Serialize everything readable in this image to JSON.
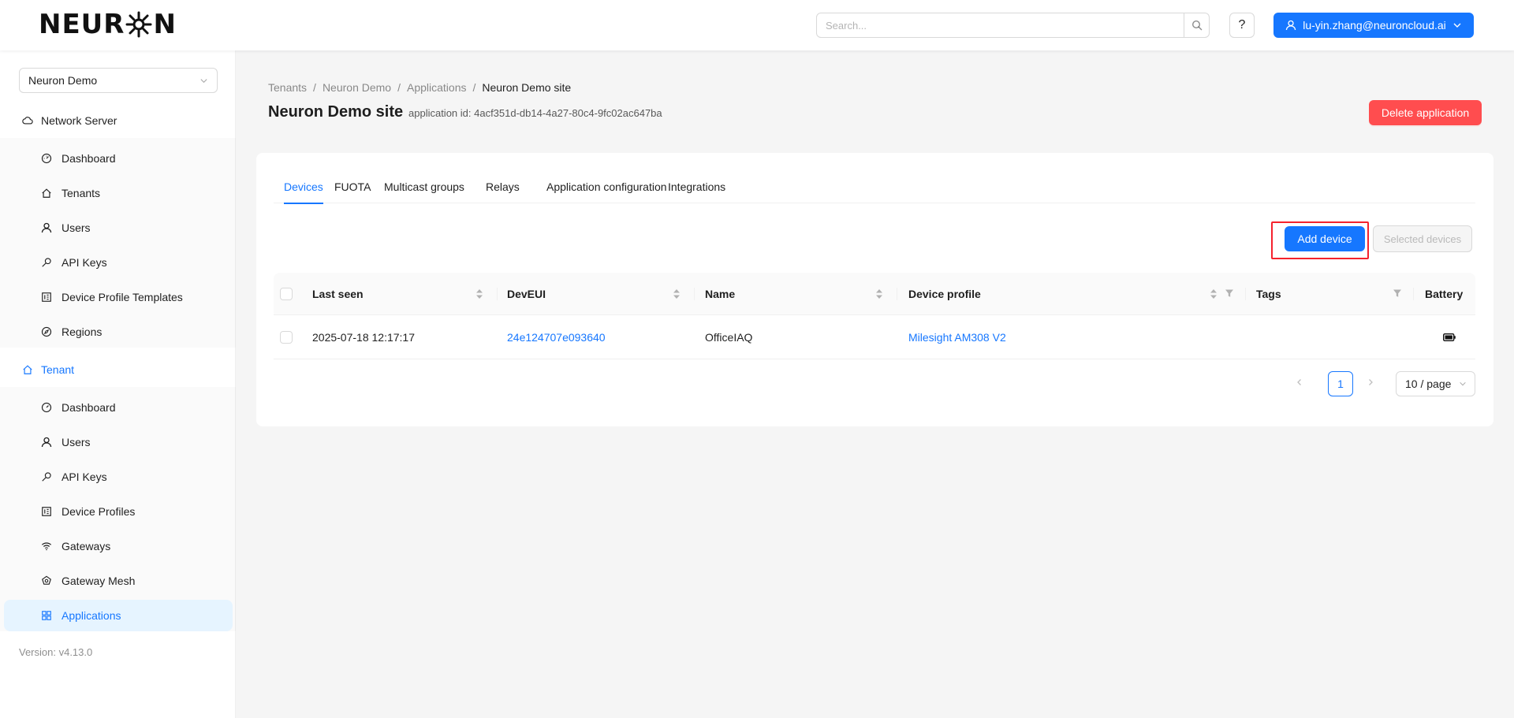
{
  "header": {
    "logo_text_left": "NEUR",
    "logo_text_right": "N",
    "search_placeholder": "Search...",
    "help_label": "?",
    "user_label": "lu-yin.zhang@neuroncloud.ai"
  },
  "sidebar": {
    "tenant_selector": "Neuron Demo",
    "network_server": {
      "label": "Network Server",
      "items": [
        {
          "label": "Dashboard",
          "icon": "dashboard-icon"
        },
        {
          "label": "Tenants",
          "icon": "home-icon"
        },
        {
          "label": "Users",
          "icon": "user-icon"
        },
        {
          "label": "API Keys",
          "icon": "key-icon"
        },
        {
          "label": "Device Profile Templates",
          "icon": "profile-icon"
        },
        {
          "label": "Regions",
          "icon": "compass-icon"
        }
      ]
    },
    "tenant": {
      "label": "Tenant",
      "items": [
        {
          "label": "Dashboard",
          "icon": "dashboard-icon"
        },
        {
          "label": "Users",
          "icon": "user-icon"
        },
        {
          "label": "API Keys",
          "icon": "key-icon"
        },
        {
          "label": "Device Profiles",
          "icon": "profile-icon"
        },
        {
          "label": "Gateways",
          "icon": "wifi-icon"
        },
        {
          "label": "Gateway Mesh",
          "icon": "mesh-icon"
        },
        {
          "label": "Applications",
          "icon": "apps-icon"
        }
      ]
    },
    "version": "Version: v4.13.0"
  },
  "breadcrumb": [
    "Tenants",
    "Neuron Demo",
    "Applications",
    "Neuron Demo site"
  ],
  "page": {
    "title": "Neuron Demo site",
    "subtitle": "application id: 4acf351d-db14-4a27-80c4-9fc02ac647ba",
    "delete_label": "Delete application"
  },
  "tabs": [
    "Devices",
    "FUOTA",
    "Multicast groups",
    "Relays",
    "Application configuration",
    "Integrations"
  ],
  "toolbar": {
    "add_device": "Add device",
    "selected_devices": "Selected devices"
  },
  "table": {
    "columns": [
      "Last seen",
      "DevEUI",
      "Name",
      "Device profile",
      "Tags",
      "Battery"
    ],
    "rows": [
      {
        "last_seen": "2025-07-18 12:17:17",
        "dev_eui": "24e124707e093640",
        "name": "OfficeIAQ",
        "device_profile": "Milesight AM308 V2",
        "tags": "",
        "battery": "battery-icon"
      }
    ]
  },
  "pagination": {
    "current": "1",
    "page_size": "10 / page"
  },
  "colors": {
    "primary": "#1677ff",
    "danger": "#ff4d4f",
    "highlight": "#f5222d"
  }
}
